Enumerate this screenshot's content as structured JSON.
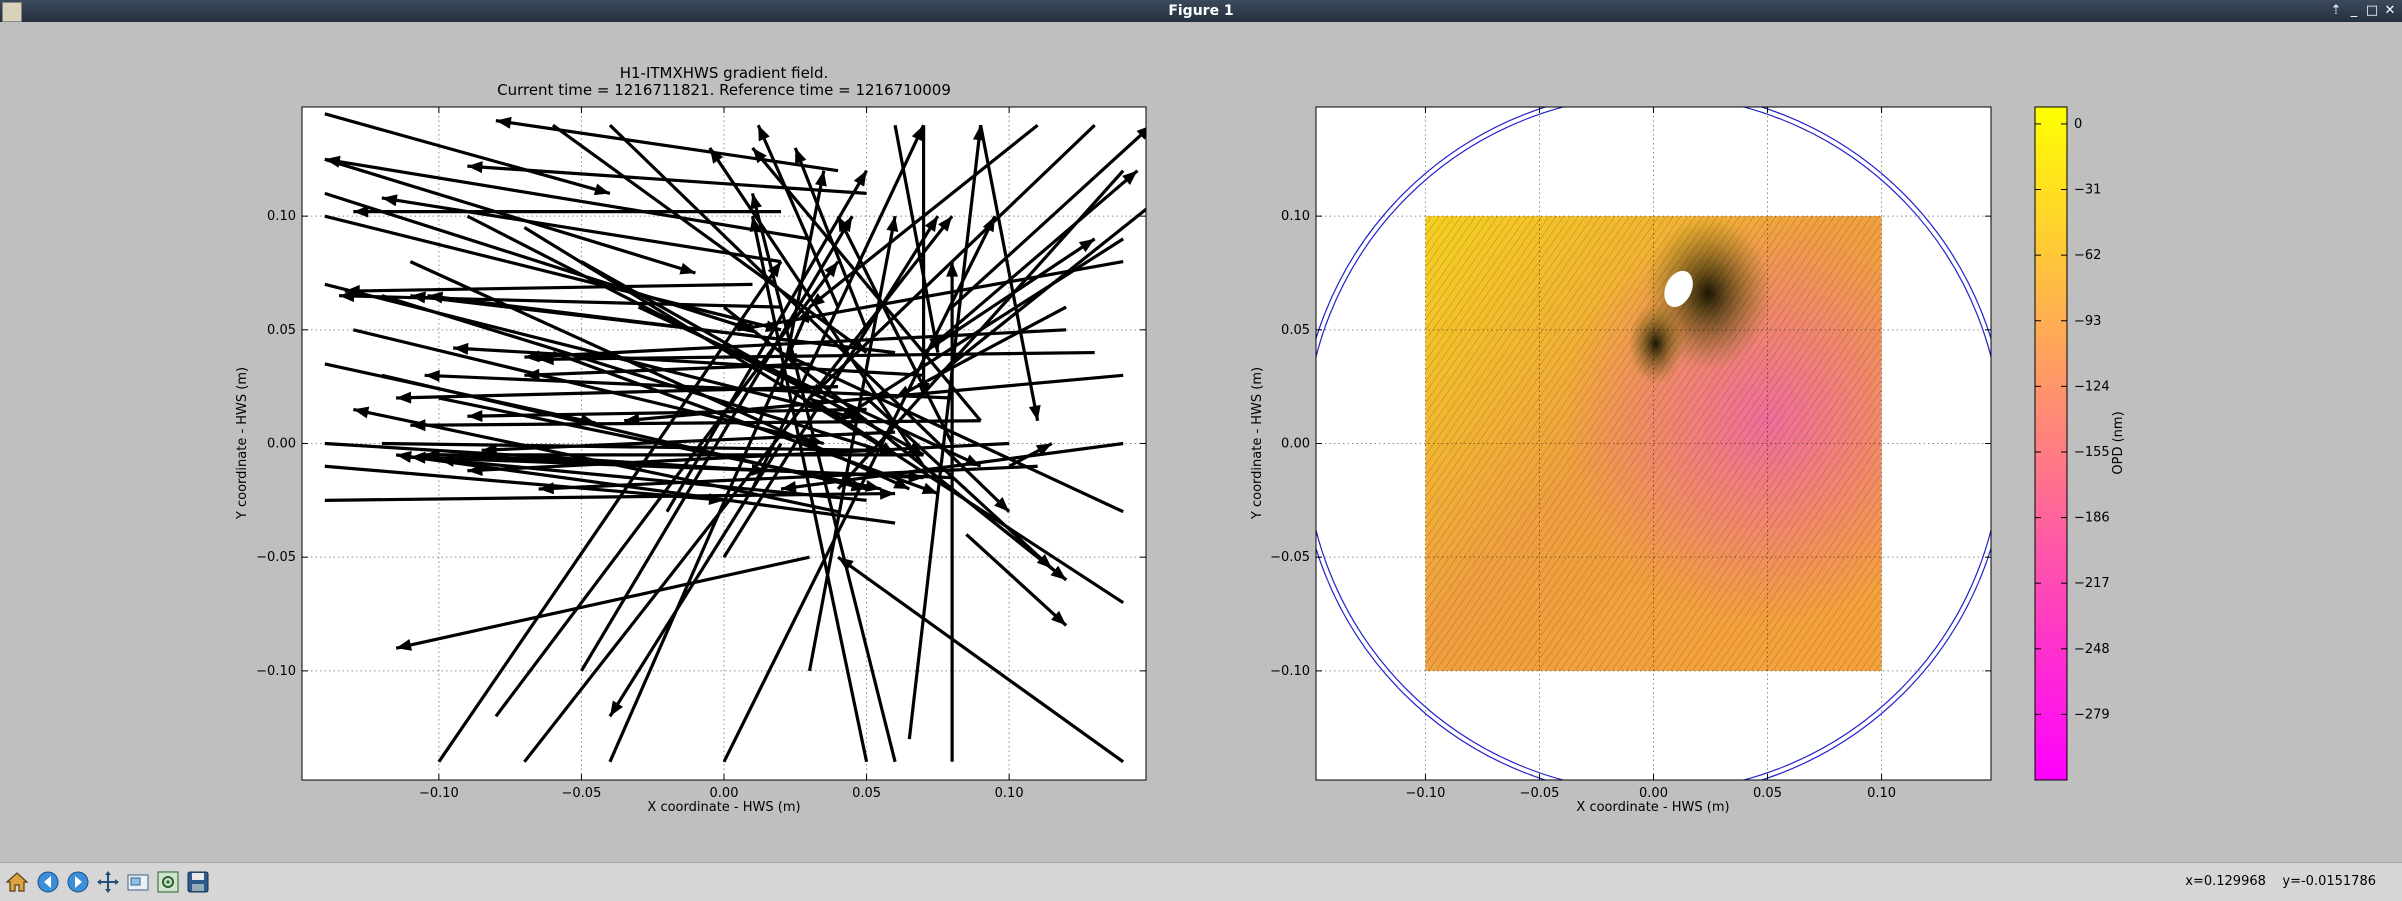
{
  "window": {
    "title": "Figure 1"
  },
  "chart_data": [
    {
      "type": "quiver",
      "title": "H1-ITMXHWS gradient field.",
      "subtitle": "Current time = 1216711821. Reference time = 1216710009",
      "xlabel": "X coordinate - HWS (m)",
      "ylabel": "Y coordinate - HWS (m)",
      "xlim": [
        -0.148,
        0.148
      ],
      "ylim": [
        -0.148,
        0.148
      ],
      "xticks": [
        "−0.10",
        "−0.05",
        "0.00",
        "0.05",
        "0.10"
      ],
      "yticks": [
        "−0.10",
        "−0.05",
        "0.00",
        "0.05",
        "0.10"
      ],
      "grid": true,
      "arrows": [
        {
          "x": 0.02,
          "y": 0.102,
          "u": -0.15,
          "v": 0.0
        },
        {
          "x": 0.03,
          "y": 0.09,
          "u": -0.17,
          "v": 0.035
        },
        {
          "x": 0.02,
          "y": 0.08,
          "u": -0.14,
          "v": 0.028
        },
        {
          "x": 0.01,
          "y": 0.07,
          "u": -0.143,
          "v": -0.003
        },
        {
          "x": 0.02,
          "y": 0.06,
          "u": -0.155,
          "v": 0.005
        },
        {
          "x": 0.025,
          "y": 0.045,
          "u": -0.129,
          "v": 0.02
        },
        {
          "x": 0.03,
          "y": 0.035,
          "u": -0.1,
          "v": -0.005
        },
        {
          "x": 0.04,
          "y": 0.025,
          "u": -0.155,
          "v": -0.005
        },
        {
          "x": 0.05,
          "y": 0.015,
          "u": -0.14,
          "v": -0.003
        },
        {
          "x": 0.06,
          "y": 0.005,
          "u": -0.145,
          "v": -0.008
        },
        {
          "x": 0.07,
          "y": -0.005,
          "u": -0.175,
          "v": 0.0
        },
        {
          "x": 0.08,
          "y": -0.015,
          "u": -0.19,
          "v": 0.009
        },
        {
          "x": 0.05,
          "y": -0.025,
          "u": -0.15,
          "v": 0.018
        },
        {
          "x": 0.04,
          "y": -0.03,
          "u": -0.17,
          "v": 0.045
        },
        {
          "x": 0.06,
          "y": -0.035,
          "u": -0.175,
          "v": 0.03
        },
        {
          "x": 0.03,
          "y": -0.05,
          "u": -0.145,
          "v": -0.04
        },
        {
          "x": 0.04,
          "y": 0.12,
          "u": -0.12,
          "v": 0.022
        },
        {
          "x": 0.05,
          "y": 0.11,
          "u": -0.14,
          "v": 0.012
        },
        {
          "x": 0.06,
          "y": 0.04,
          "u": -0.17,
          "v": 0.025
        },
        {
          "x": 0.07,
          "y": 0.03,
          "u": -0.165,
          "v": 0.012
        },
        {
          "x": 0.08,
          "y": 0.02,
          "u": -0.185,
          "v": 0.01
        },
        {
          "x": 0.09,
          "y": 0.01,
          "u": -0.2,
          "v": -0.002
        },
        {
          "x": 0.1,
          "y": 0.0,
          "u": -0.19,
          "v": -0.012
        },
        {
          "x": 0.11,
          "y": -0.01,
          "u": -0.175,
          "v": -0.01
        },
        {
          "x": 0.12,
          "y": 0.05,
          "u": -0.19,
          "v": -0.012
        },
        {
          "x": 0.13,
          "y": 0.04,
          "u": -0.195,
          "v": -0.003
        },
        {
          "x": 0.14,
          "y": 0.03,
          "u": -0.175,
          "v": -0.02
        },
        {
          "x": -0.1,
          "y": 0.02,
          "u": 0.155,
          "v": -0.04
        },
        {
          "x": -0.12,
          "y": 0.03,
          "u": 0.17,
          "v": -0.05
        },
        {
          "x": -0.13,
          "y": 0.05,
          "u": 0.165,
          "v": -0.05
        },
        {
          "x": -0.14,
          "y": 0.07,
          "u": 0.19,
          "v": -0.06
        },
        {
          "x": -0.11,
          "y": 0.08,
          "u": 0.175,
          "v": -0.1
        },
        {
          "x": -0.09,
          "y": 0.1,
          "u": 0.14,
          "v": -0.09
        },
        {
          "x": -0.07,
          "y": 0.095,
          "u": 0.13,
          "v": -0.1
        },
        {
          "x": -0.05,
          "y": 0.08,
          "u": 0.12,
          "v": -0.085
        },
        {
          "x": -0.03,
          "y": 0.06,
          "u": 0.12,
          "v": -0.07
        },
        {
          "x": -0.06,
          "y": 0.04,
          "u": 0.135,
          "v": -0.062
        },
        {
          "x": 0.02,
          "y": 0.025,
          "u": 0.015,
          "v": 0.095
        },
        {
          "x": 0.01,
          "y": -0.02,
          "u": 0.06,
          "v": 0.16
        },
        {
          "x": -0.02,
          "y": -0.03,
          "u": 0.07,
          "v": 0.15
        },
        {
          "x": -0.07,
          "y": -0.14,
          "u": 0.15,
          "v": 0.24
        },
        {
          "x": -0.1,
          "y": -0.14,
          "u": 0.12,
          "v": 0.22
        },
        {
          "x": 0.09,
          "y": 0.01,
          "u": -0.08,
          "v": 0.12
        },
        {
          "x": 0.08,
          "y": 0.0,
          "u": -0.04,
          "v": 0.1
        },
        {
          "x": 0.07,
          "y": -0.01,
          "u": -0.075,
          "v": 0.14
        },
        {
          "x": 0.075,
          "y": 0.045,
          "u": 0.07,
          "v": 0.075
        },
        {
          "x": 0.08,
          "y": 0.06,
          "u": 0.07,
          "v": 0.08
        },
        {
          "x": 0.075,
          "y": 0.03,
          "u": 0.1,
          "v": 0.1
        },
        {
          "x": 0.07,
          "y": 0.04,
          "u": 0.06,
          "v": 0.05
        },
        {
          "x": 0.065,
          "y": -0.13,
          "u": 0.025,
          "v": 0.27
        },
        {
          "x": 0.08,
          "y": -0.14,
          "u": 0.0,
          "v": 0.22
        },
        {
          "x": 0.06,
          "y": -0.14,
          "u": -0.05,
          "v": 0.25
        },
        {
          "x": 0.05,
          "y": -0.14,
          "u": -0.04,
          "v": 0.24
        },
        {
          "x": -0.05,
          "y": -0.1,
          "u": 0.095,
          "v": 0.2
        },
        {
          "x": -0.08,
          "y": -0.12,
          "u": 0.12,
          "v": 0.2
        },
        {
          "x": 0.0,
          "y": -0.05,
          "u": 0.075,
          "v": 0.15
        },
        {
          "x": 0.02,
          "y": 0.0,
          "u": -0.06,
          "v": -0.12
        },
        {
          "x": 0.03,
          "y": -0.1,
          "u": 0.03,
          "v": 0.2
        },
        {
          "x": 0.0,
          "y": -0.14,
          "u": 0.095,
          "v": 0.24
        },
        {
          "x": -0.04,
          "y": -0.14,
          "u": 0.07,
          "v": 0.2
        },
        {
          "x": 0.14,
          "y": -0.14,
          "u": -0.1,
          "v": 0.09
        },
        {
          "x": 0.14,
          "y": -0.07,
          "u": -0.11,
          "v": 0.09
        },
        {
          "x": 0.14,
          "y": -0.03,
          "u": -0.12,
          "v": 0.07
        },
        {
          "x": 0.14,
          "y": 0.12,
          "u": -0.1,
          "v": -0.14
        },
        {
          "x": 0.13,
          "y": 0.14,
          "u": -0.1,
          "v": -0.12
        },
        {
          "x": 0.09,
          "y": 0.14,
          "u": 0.02,
          "v": -0.13
        },
        {
          "x": 0.07,
          "y": 0.14,
          "u": 0.0,
          "v": -0.12
        },
        {
          "x": 0.06,
          "y": 0.14,
          "u": 0.015,
          "v": -0.1
        },
        {
          "x": 0.05,
          "y": 0.05,
          "u": -0.025,
          "v": 0.08
        },
        {
          "x": 0.04,
          "y": 0.06,
          "u": -0.028,
          "v": 0.08
        },
        {
          "x": 0.05,
          "y": 0.02,
          "u": 0.065,
          "v": -0.075
        },
        {
          "x": 0.06,
          "y": 0.0,
          "u": 0.06,
          "v": -0.06
        },
        {
          "x": 0.0,
          "y": 0.06,
          "u": 0.12,
          "v": -0.12
        },
        {
          "x": -0.04,
          "y": 0.14,
          "u": 0.14,
          "v": -0.17
        },
        {
          "x": -0.06,
          "y": 0.14,
          "u": 0.11,
          "v": -0.1
        },
        {
          "x": 0.11,
          "y": 0.14,
          "u": -0.08,
          "v": -0.08
        },
        {
          "x": 0.12,
          "y": 0.06,
          "u": -0.06,
          "v": -0.04
        },
        {
          "x": 0.1,
          "y": -0.01,
          "u": 0.015,
          "v": 0.01
        },
        {
          "x": 0.085,
          "y": -0.04,
          "u": 0.035,
          "v": -0.04
        },
        {
          "x": -0.14,
          "y": 0.0,
          "u": 0.155,
          "v": -0.012
        },
        {
          "x": -0.14,
          "y": -0.01,
          "u": 0.14,
          "v": -0.015
        },
        {
          "x": -0.14,
          "y": -0.025,
          "u": 0.2,
          "v": 0.003
        },
        {
          "x": -0.14,
          "y": 0.035,
          "u": 0.095,
          "v": -0.026
        },
        {
          "x": -0.14,
          "y": 0.1,
          "u": 0.16,
          "v": -0.05
        },
        {
          "x": -0.14,
          "y": 0.11,
          "u": 0.15,
          "v": -0.06
        },
        {
          "x": -0.14,
          "y": 0.145,
          "u": 0.1,
          "v": -0.035
        },
        {
          "x": -0.14,
          "y": 0.125,
          "u": 0.13,
          "v": -0.05
        },
        {
          "x": -0.12,
          "y": 0.0,
          "u": 0.175,
          "v": -0.003
        },
        {
          "x": -0.1,
          "y": -0.005,
          "u": 0.17,
          "v": -0.01
        },
        {
          "x": -0.12,
          "y": 0.065,
          "u": 0.18,
          "v": -0.07
        },
        {
          "x": 0.14,
          "y": 0.08,
          "u": -0.135,
          "v": -0.03
        },
        {
          "x": 0.14,
          "y": 0.09,
          "u": -0.1,
          "v": -0.08
        },
        {
          "x": 0.14,
          "y": 0.0,
          "u": -0.12,
          "v": -0.02
        }
      ]
    },
    {
      "type": "heatmap",
      "title": "",
      "xlabel": "X coordinate - HWS (m)",
      "ylabel": "Y coordinate - HWS (m)",
      "xlim": [
        -0.148,
        0.148
      ],
      "ylim": [
        -0.148,
        0.148
      ],
      "xticks": [
        "−0.10",
        "−0.05",
        "0.00",
        "0.05",
        "0.10"
      ],
      "yticks": [
        "−0.10",
        "−0.05",
        "0.00",
        "0.05",
        "0.10"
      ],
      "grid": true,
      "data_extent": {
        "x": [
          -0.1,
          0.1
        ],
        "y": [
          -0.1,
          0.1
        ]
      },
      "aperture_circle_radius": 0.155,
      "aperture_color": "#2222cc",
      "colorbar": {
        "label": "OPD (nm)",
        "range": [
          -310,
          8
        ],
        "ticks": [
          "0",
          "−31",
          "−62",
          "−93",
          "−124",
          "−155",
          "−186",
          "−217",
          "−248",
          "−279"
        ],
        "colors": [
          "#ffff00",
          "#ff00ff"
        ]
      }
    }
  ],
  "toolbar": {
    "buttons": [
      {
        "name": "home-icon"
      },
      {
        "name": "back-icon"
      },
      {
        "name": "forward-icon"
      },
      {
        "name": "pan-icon"
      },
      {
        "name": "zoom-icon"
      },
      {
        "name": "configure-subplots-icon"
      },
      {
        "name": "save-icon"
      }
    ],
    "coords": "x=0.129968    y=-0.0151786"
  }
}
